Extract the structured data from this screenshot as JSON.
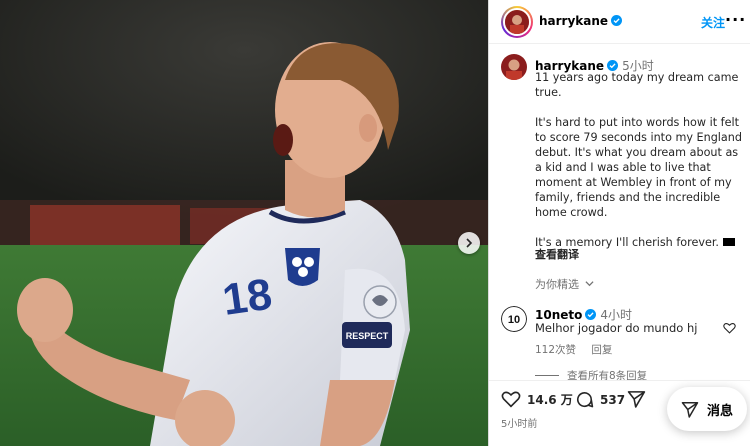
{
  "header": {
    "username": "harrykane",
    "follow_label": "关注",
    "more_label": "···"
  },
  "caption": {
    "author": "harrykane",
    "time": "5小时",
    "paragraphs": [
      "11 years ago today my dream came true.",
      "It's hard to put into words how it felt to score 79 seconds into my England debut. It's what you dream about as a kid and I was able to live that moment at Wembley in front of my family, friends and the incredible home crowd.",
      "It's a memory I'll cherish forever."
    ],
    "translate_label": "查看翻译"
  },
  "curated_label": "为你精选",
  "comment": {
    "username": "10neto",
    "time": "4小时",
    "text": "Melhor jogador do mundo hj",
    "likes": "112次赞",
    "reply_label": "回复",
    "view_replies": "查看所有8条回复"
  },
  "actions": {
    "likes": "14.6 万",
    "comments": "537",
    "timestamp": "5小时前"
  },
  "message_button": "消息",
  "photo": {
    "shirt_number": "18",
    "sleeve_badge": "RESPECT"
  },
  "colors": {
    "link": "#0095f6",
    "verified": "#0095f6",
    "muted": "#737373",
    "pitch": "#2e6a2a"
  },
  "icons": [
    "verified-badge-icon",
    "more-icon",
    "heart-icon",
    "comment-icon",
    "share-icon",
    "send-icon",
    "chevron-down-icon",
    "chevron-right-icon"
  ]
}
